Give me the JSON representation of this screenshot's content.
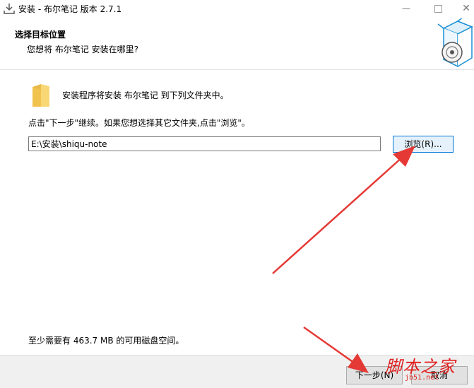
{
  "window": {
    "title": "安装 - 布尔笔记 版本 2.7.1",
    "minimize_glyph": "—",
    "close_glyph": "✕"
  },
  "header": {
    "title": "选择目标位置",
    "subtitle": "您想将 布尔笔记 安装在哪里?"
  },
  "body": {
    "info_text": "安装程序将安装 布尔笔记 到下列文件夹中。",
    "instruction": "点击\"下一步\"继续。如果您想选择其它文件夹,点击\"浏览\"。",
    "path_value": "E:\\安装\\shiqu-note",
    "browse_label": "浏览(R)...",
    "space_text": "至少需要有 463.7 MB 的可用磁盘空间。"
  },
  "footer": {
    "next_label": "下一步(N)",
    "cancel_label": "取消"
  },
  "watermark": {
    "main": "脚本之家",
    "sub": "jb51.net"
  },
  "colors": {
    "accent_border": "#0078d7",
    "arrow_red": "#e53935",
    "folder_yellow": "#f8d775"
  }
}
